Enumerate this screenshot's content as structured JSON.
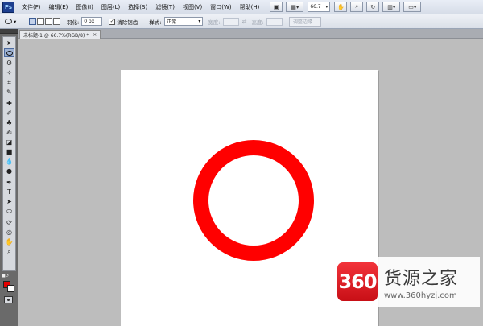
{
  "app": {
    "logo": "Ps"
  },
  "menu": {
    "items": [
      "文件(F)",
      "编辑(E)",
      "图像(I)",
      "图层(L)",
      "选择(S)",
      "滤镜(T)",
      "视图(V)",
      "窗口(W)",
      "帮助(H)"
    ],
    "zoom": "66.7"
  },
  "options": {
    "feather_label": "羽化:",
    "feather_value": "0 px",
    "antialias_label": "消除锯齿",
    "antialias_checked": true,
    "style_label": "样式:",
    "style_value": "正常",
    "width_label": "宽度:",
    "height_label": "高度:",
    "refine_edge": "调整边缘..."
  },
  "document": {
    "tab_title": "未标题-1 @ 66.7%(RGB/8) *",
    "close": "×"
  },
  "colors": {
    "foreground": "#e50000",
    "background": "#ffffff",
    "ring": "#ff0000"
  },
  "watermark": {
    "logo": "360",
    "title": "货源之家",
    "url": "www.360hyzj.com"
  }
}
